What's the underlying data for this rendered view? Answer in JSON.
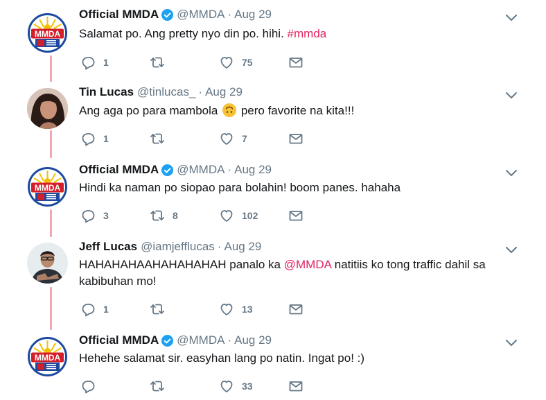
{
  "tweets": [
    {
      "name": "Official MMDA",
      "verified": true,
      "handle": "@MMDA",
      "dot": "·",
      "date": "Aug 29",
      "text": "Salamat po. Ang pretty nyo din po. hihi.",
      "hashtag": "#mmda",
      "replies": "1",
      "retweets": "",
      "likes": "75"
    },
    {
      "name": "Tin Lucas",
      "handle": "@tinlucas_",
      "dot": "·",
      "date": "Aug 29",
      "text_before_emoji": "Ang aga po para mambola",
      "text_after_emoji": "pero favorite na kita!!!",
      "emoji": "upside-down-face",
      "replies": "1",
      "retweets": "",
      "likes": "7"
    },
    {
      "name": "Official MMDA",
      "verified": true,
      "handle": "@MMDA",
      "dot": "·",
      "date": "Aug 29",
      "text": "Hindi ka naman po siopao para bolahin! boom panes. hahaha",
      "replies": "3",
      "retweets": "8",
      "likes": "102"
    },
    {
      "name": "Jeff Lucas",
      "handle": "@iamjefflucas",
      "dot": "·",
      "date": "Aug 29",
      "text_before_mention": "HAHAHAHAAHAHAHAHAH panalo ka",
      "mention": "@MMDA",
      "text_after_mention": "natitiis ko tong traffic dahil sa kabibuhan mo!",
      "replies": "1",
      "retweets": "",
      "likes": "13"
    },
    {
      "name": "Official MMDA",
      "verified": true,
      "handle": "@MMDA",
      "dot": "·",
      "date": "Aug 29",
      "text": "Hehehe salamat sir. easyhan lang po natin. Ingat po! :)",
      "replies": "",
      "retweets": "",
      "likes": "33"
    }
  ],
  "mmda_logo_text": "MMDA",
  "colors": {
    "accent": "#e0245e",
    "thread_line": "#f2a7b3",
    "secondary_text": "#657786",
    "verified": "#1da1f2"
  },
  "icons": [
    "reply-icon",
    "retweet-icon",
    "like-icon",
    "message-icon",
    "chevron-down-icon",
    "verified-badge-icon"
  ]
}
